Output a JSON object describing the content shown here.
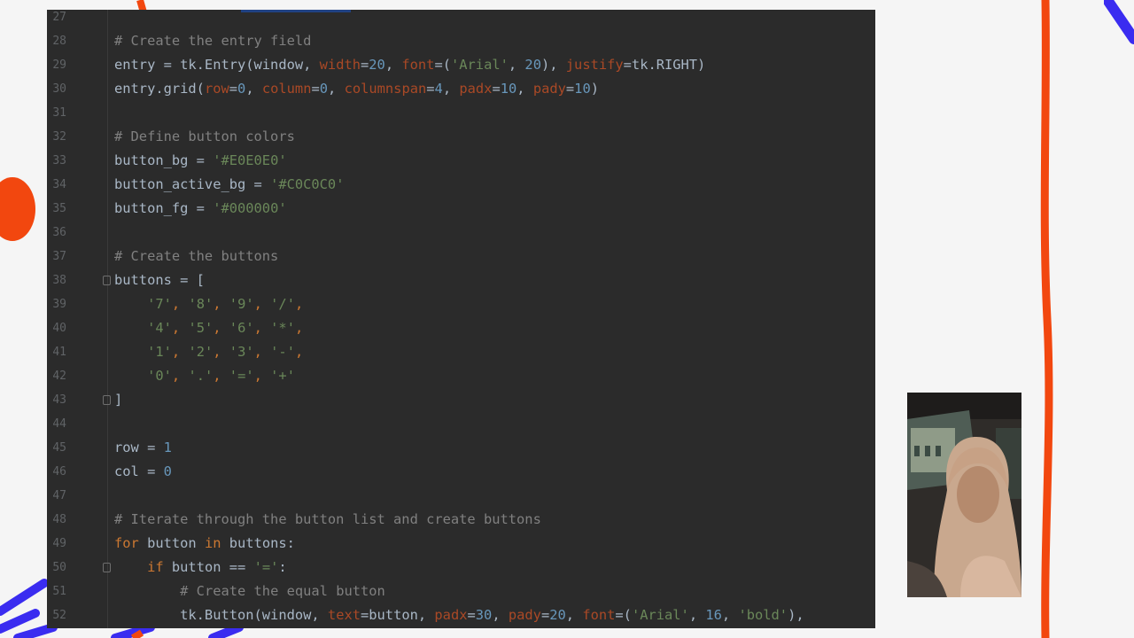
{
  "editor": {
    "lines": [
      {
        "num": "27",
        "tokens": []
      },
      {
        "num": "28",
        "tokens": [
          {
            "t": "# Create the entry field",
            "c": "com"
          }
        ]
      },
      {
        "num": "29",
        "tokens": [
          {
            "t": "entry = tk.Entry(window, ",
            "c": "def"
          },
          {
            "t": "width",
            "c": "kwarg"
          },
          {
            "t": "=",
            "c": "def"
          },
          {
            "t": "20",
            "c": "num"
          },
          {
            "t": ", ",
            "c": "def"
          },
          {
            "t": "font",
            "c": "kwarg"
          },
          {
            "t": "=(",
            "c": "def"
          },
          {
            "t": "'Arial'",
            "c": "str"
          },
          {
            "t": ", ",
            "c": "def"
          },
          {
            "t": "20",
            "c": "num"
          },
          {
            "t": "), ",
            "c": "def"
          },
          {
            "t": "justify",
            "c": "kwarg"
          },
          {
            "t": "=tk.RIGHT)",
            "c": "def"
          }
        ]
      },
      {
        "num": "30",
        "tokens": [
          {
            "t": "entry.grid(",
            "c": "def"
          },
          {
            "t": "row",
            "c": "kwarg"
          },
          {
            "t": "=",
            "c": "def"
          },
          {
            "t": "0",
            "c": "num"
          },
          {
            "t": ", ",
            "c": "def"
          },
          {
            "t": "column",
            "c": "kwarg"
          },
          {
            "t": "=",
            "c": "def"
          },
          {
            "t": "0",
            "c": "num"
          },
          {
            "t": ", ",
            "c": "def"
          },
          {
            "t": "columnspan",
            "c": "kwarg"
          },
          {
            "t": "=",
            "c": "def"
          },
          {
            "t": "4",
            "c": "num"
          },
          {
            "t": ", ",
            "c": "def"
          },
          {
            "t": "padx",
            "c": "kwarg"
          },
          {
            "t": "=",
            "c": "def"
          },
          {
            "t": "10",
            "c": "num"
          },
          {
            "t": ", ",
            "c": "def"
          },
          {
            "t": "pady",
            "c": "kwarg"
          },
          {
            "t": "=",
            "c": "def"
          },
          {
            "t": "10",
            "c": "num"
          },
          {
            "t": ")",
            "c": "def"
          }
        ]
      },
      {
        "num": "31",
        "tokens": []
      },
      {
        "num": "32",
        "tokens": [
          {
            "t": "# Define button colors",
            "c": "com"
          }
        ]
      },
      {
        "num": "33",
        "tokens": [
          {
            "t": "button_bg = ",
            "c": "def"
          },
          {
            "t": "'#E0E0E0'",
            "c": "str"
          }
        ]
      },
      {
        "num": "34",
        "tokens": [
          {
            "t": "button_active_bg = ",
            "c": "def"
          },
          {
            "t": "'#C0C0C0'",
            "c": "str"
          }
        ]
      },
      {
        "num": "35",
        "tokens": [
          {
            "t": "button_fg = ",
            "c": "def"
          },
          {
            "t": "'#000000'",
            "c": "str"
          }
        ]
      },
      {
        "num": "36",
        "tokens": []
      },
      {
        "num": "37",
        "tokens": [
          {
            "t": "# Create the buttons",
            "c": "com"
          }
        ]
      },
      {
        "num": "38",
        "fold": true,
        "tokens": [
          {
            "t": "buttons = [",
            "c": "def"
          }
        ]
      },
      {
        "num": "39",
        "tokens": [
          {
            "t": "    ",
            "c": "def"
          },
          {
            "t": "'7'",
            "c": "str"
          },
          {
            "t": ", ",
            "c": "kw"
          },
          {
            "t": "'8'",
            "c": "str"
          },
          {
            "t": ", ",
            "c": "kw"
          },
          {
            "t": "'9'",
            "c": "str"
          },
          {
            "t": ", ",
            "c": "kw"
          },
          {
            "t": "'/'",
            "c": "str"
          },
          {
            "t": ",",
            "c": "kw"
          }
        ]
      },
      {
        "num": "40",
        "tokens": [
          {
            "t": "    ",
            "c": "def"
          },
          {
            "t": "'4'",
            "c": "str"
          },
          {
            "t": ", ",
            "c": "kw"
          },
          {
            "t": "'5'",
            "c": "str"
          },
          {
            "t": ", ",
            "c": "kw"
          },
          {
            "t": "'6'",
            "c": "str"
          },
          {
            "t": ", ",
            "c": "kw"
          },
          {
            "t": "'*'",
            "c": "str"
          },
          {
            "t": ",",
            "c": "kw"
          }
        ]
      },
      {
        "num": "41",
        "tokens": [
          {
            "t": "    ",
            "c": "def"
          },
          {
            "t": "'1'",
            "c": "str"
          },
          {
            "t": ", ",
            "c": "kw"
          },
          {
            "t": "'2'",
            "c": "str"
          },
          {
            "t": ", ",
            "c": "kw"
          },
          {
            "t": "'3'",
            "c": "str"
          },
          {
            "t": ", ",
            "c": "kw"
          },
          {
            "t": "'-'",
            "c": "str"
          },
          {
            "t": ",",
            "c": "kw"
          }
        ]
      },
      {
        "num": "42",
        "tokens": [
          {
            "t": "    ",
            "c": "def"
          },
          {
            "t": "'0'",
            "c": "str"
          },
          {
            "t": ", ",
            "c": "kw"
          },
          {
            "t": "'.'",
            "c": "str"
          },
          {
            "t": ", ",
            "c": "kw"
          },
          {
            "t": "'='",
            "c": "str"
          },
          {
            "t": ", ",
            "c": "kw"
          },
          {
            "t": "'+'",
            "c": "str"
          }
        ]
      },
      {
        "num": "43",
        "fold": true,
        "tokens": [
          {
            "t": "]",
            "c": "def"
          }
        ]
      },
      {
        "num": "44",
        "tokens": []
      },
      {
        "num": "45",
        "tokens": [
          {
            "t": "row = ",
            "c": "def"
          },
          {
            "t": "1",
            "c": "num"
          }
        ]
      },
      {
        "num": "46",
        "tokens": [
          {
            "t": "col = ",
            "c": "def"
          },
          {
            "t": "0",
            "c": "num"
          }
        ]
      },
      {
        "num": "47",
        "tokens": []
      },
      {
        "num": "48",
        "tokens": [
          {
            "t": "# Iterate through the button list and create buttons",
            "c": "com"
          }
        ]
      },
      {
        "num": "49",
        "tokens": [
          {
            "t": "for ",
            "c": "kw"
          },
          {
            "t": "button ",
            "c": "def"
          },
          {
            "t": "in ",
            "c": "kw"
          },
          {
            "t": "buttons:",
            "c": "def"
          }
        ]
      },
      {
        "num": "50",
        "fold": true,
        "tokens": [
          {
            "t": "    ",
            "c": "def"
          },
          {
            "t": "if ",
            "c": "kw"
          },
          {
            "t": "button == ",
            "c": "def"
          },
          {
            "t": "'='",
            "c": "str"
          },
          {
            "t": ":",
            "c": "def"
          }
        ]
      },
      {
        "num": "51",
        "tokens": [
          {
            "t": "        ",
            "c": "def"
          },
          {
            "t": "# Create the equal button",
            "c": "com"
          }
        ]
      },
      {
        "num": "52",
        "tokens": [
          {
            "t": "        tk.Button(window, ",
            "c": "def"
          },
          {
            "t": "text",
            "c": "kwarg"
          },
          {
            "t": "=button, ",
            "c": "def"
          },
          {
            "t": "padx",
            "c": "kwarg"
          },
          {
            "t": "=",
            "c": "def"
          },
          {
            "t": "30",
            "c": "num"
          },
          {
            "t": ", ",
            "c": "def"
          },
          {
            "t": "pady",
            "c": "kwarg"
          },
          {
            "t": "=",
            "c": "def"
          },
          {
            "t": "20",
            "c": "num"
          },
          {
            "t": ", ",
            "c": "def"
          },
          {
            "t": "font",
            "c": "kwarg"
          },
          {
            "t": "=(",
            "c": "def"
          },
          {
            "t": "'Arial'",
            "c": "str"
          },
          {
            "t": ", ",
            "c": "def"
          },
          {
            "t": "16",
            "c": "num"
          },
          {
            "t": ", ",
            "c": "def"
          },
          {
            "t": "'bold'",
            "c": "str"
          },
          {
            "t": "),",
            "c": "def"
          }
        ]
      }
    ]
  },
  "colors": {
    "editor_bg": "#2b2b2b",
    "comment": "#808080",
    "keyword": "#cc7832",
    "string": "#6a8759",
    "number": "#6897bb",
    "kwarg": "#aa4926",
    "default": "#a9b7c6",
    "accent_red": "#f2470f",
    "accent_blue": "#3a2cf0"
  },
  "webcam": {
    "icon": "person-webcam"
  }
}
